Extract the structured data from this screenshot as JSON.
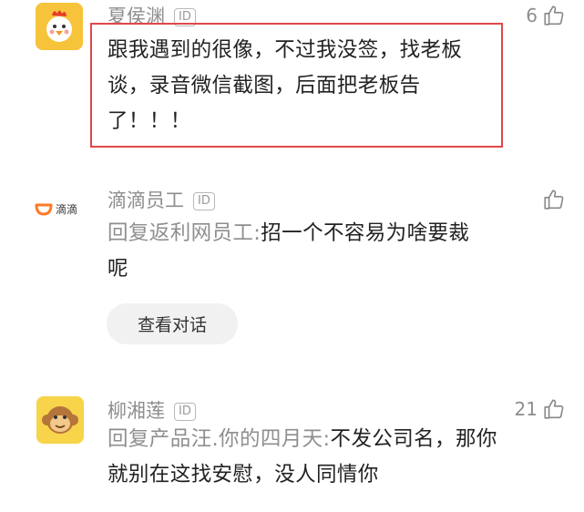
{
  "comments": [
    {
      "user": "夏侯渊",
      "badge": "ID",
      "likes": "6",
      "text": "跟我遇到的很像，不过我没签，找老板谈，录音微信截图，后面把老板告了！！！",
      "highlighted": true
    },
    {
      "user": "滴滴员工",
      "badge": "ID",
      "likes": "",
      "logo_text": "滴滴",
      "reply_prefix": "回复返利网员工:",
      "text": "招一个不容易为啥要裁呢",
      "action": "查看对话"
    },
    {
      "user": "柳湘莲",
      "badge": "ID",
      "likes": "21",
      "reply_prefix": "回复产品汪.你的四月天:",
      "text": "不发公司名，那你就别在这找安慰，没人同情你"
    }
  ],
  "colors": {
    "highlight_border": "#e04848",
    "muted_text": "#8e8e8e",
    "body_text": "#222222"
  },
  "icons": {
    "like": "thumbs-up-icon"
  }
}
